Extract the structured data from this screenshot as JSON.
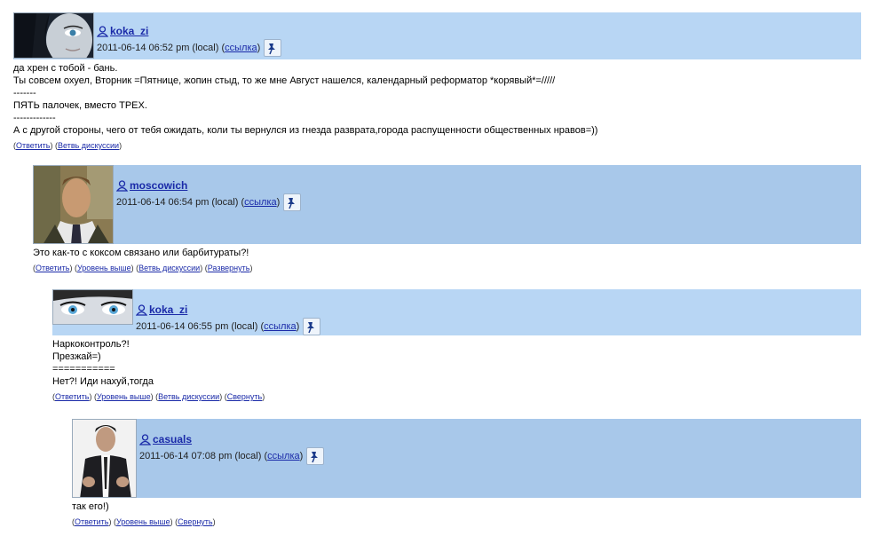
{
  "comments": [
    {
      "username": "koka_zi",
      "datetime": "2011-06-14 06:52 pm (local)",
      "link_label": "ссылка",
      "body": "да хрен с тобой - бань.\nТы совсем охуел, Вторник =Пятнице, жопин стыд, то же мне Август нашелся, календарный реформатор *корявый*=/////\n-------\nПЯТЬ палочек, вместо ТРЕХ.\n-------------\nА с другой стороны, чего от тебя ожидать, коли ты вернулся из гнезда разврата,города распущенности общественных нравов=))",
      "actions": [
        "Ответить",
        "Ветвь дискуссии"
      ]
    },
    {
      "username": "moscowich",
      "datetime": "2011-06-14 06:54 pm (local)",
      "link_label": "ссылка",
      "body": "Это как-то с коксом связано или барбитураты?!",
      "actions": [
        "Ответить",
        "Уровень выше",
        "Ветвь дискуссии",
        "Развернуть"
      ]
    },
    {
      "username": "koka_zi",
      "datetime": "2011-06-14 06:55 pm (local)",
      "link_label": "ссылка",
      "body": "Наркоконтроль?!\nПрезжай=)\n===========\nНет?! Иди нахуй,тогда",
      "actions": [
        "Ответить",
        "Уровень выше",
        "Ветвь дискуссии",
        "Свернуть"
      ]
    },
    {
      "username": "casuals",
      "datetime": "2011-06-14 07:08 pm (local)",
      "link_label": "ссылка",
      "body": "так его!)",
      "actions": [
        "Ответить",
        "Уровень выше",
        "Свернуть"
      ]
    }
  ],
  "icons": {
    "user": "user-icon",
    "pin": "pin-icon"
  },
  "colors": {
    "header_bg": "#b8d6f4",
    "header_bg_alt": "#a8c8ea",
    "link": "#1a2aa8"
  }
}
